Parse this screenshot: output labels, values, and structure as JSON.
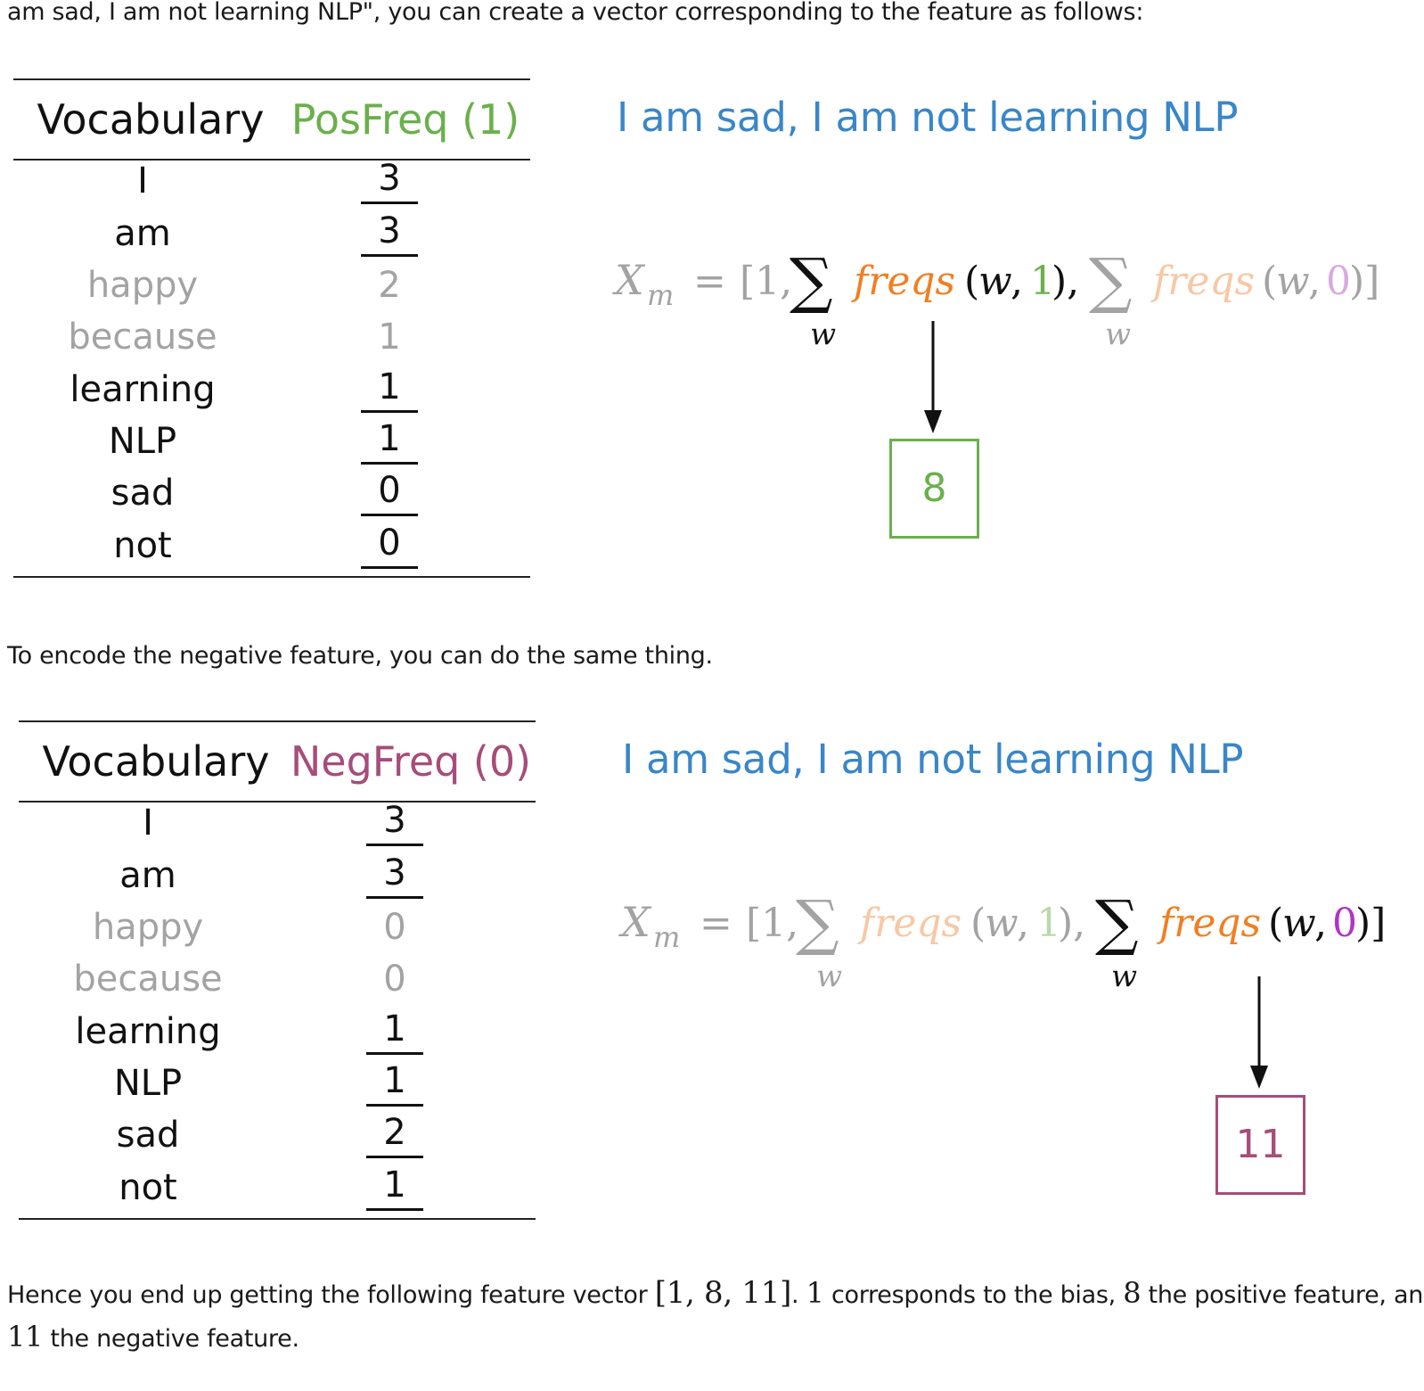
{
  "intro_text": "am sad, I am not learning NLP\", you can create a vector corresponding to the feature as follows:",
  "middle_text": "To encode the negative feature, you can do the same thing.",
  "positive": {
    "header_vocab": "Vocabulary",
    "header_freq": "PosFreq (1)",
    "rows": [
      {
        "word": "I",
        "value": "3"
      },
      {
        "word": "am",
        "value": "3"
      },
      {
        "word": "happy",
        "value": "2"
      },
      {
        "word": "because",
        "value": "1"
      },
      {
        "word": "learning",
        "value": "1"
      },
      {
        "word": "NLP",
        "value": "1"
      },
      {
        "word": "sad",
        "value": "0"
      },
      {
        "word": "not",
        "value": "0"
      }
    ],
    "sentence": "I am sad, I am not learning NLP",
    "result": "8"
  },
  "negative": {
    "header_vocab": "Vocabulary",
    "header_freq": "NegFreq (0)",
    "rows": [
      {
        "word": "I",
        "value": "3"
      },
      {
        "word": "am",
        "value": "3"
      },
      {
        "word": "happy",
        "value": "0"
      },
      {
        "word": "because",
        "value": "0"
      },
      {
        "word": "learning",
        "value": "1"
      },
      {
        "word": "NLP",
        "value": "1"
      },
      {
        "word": "sad",
        "value": "2"
      },
      {
        "word": "not",
        "value": "1"
      }
    ],
    "sentence": "I am sad, I am not learning NLP",
    "result": "11"
  },
  "formula": {
    "lhs": "X",
    "lhs_sub": "m",
    "equals": "=",
    "open": "[1,",
    "func": "freqs",
    "arg_w": "w",
    "pos_label": "1",
    "neg_label": "0",
    "sum_index": "w"
  },
  "conclusion": {
    "pre": "Hence you end up getting the following feature vector ",
    "vector": "[1, 8, 11]",
    "mid1": ". ",
    "one": "1",
    "mid2": " corresponds to the bias, ",
    "eight": "8",
    "mid3": " the positive feature, and",
    "eleven": "11",
    "tail": " the negative feature."
  },
  "colors": {
    "blue": "#3a86c8",
    "green": "#6ab04c",
    "orange": "#f07f22",
    "orange_faded": "#f8c7a4",
    "purple": "#a64d79",
    "violet": "#b033c8",
    "violet_faded": "#d9a9e2",
    "green_faded": "#b9d9a9",
    "gray": "#a3a3a3"
  }
}
